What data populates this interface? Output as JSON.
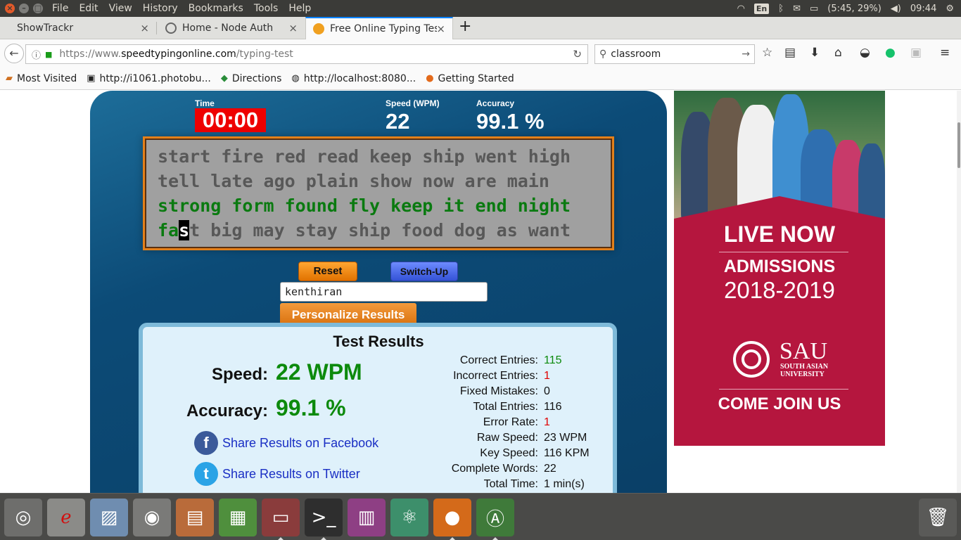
{
  "menubar": {
    "items": [
      "File",
      "Edit",
      "View",
      "History",
      "Bookmarks",
      "Tools",
      "Help"
    ],
    "tray": {
      "lang": "En",
      "battery": "(5:45, 29%)",
      "clock": "09:44"
    }
  },
  "tabs": [
    {
      "label": "ShowTrackr"
    },
    {
      "label": "Home - Node Auth"
    },
    {
      "label": "Free Online Typing Tes"
    }
  ],
  "navbar": {
    "url_prefix": "https://www.",
    "url_domain": "speedtypingonline.com",
    "url_path": "/typing-test",
    "search_value": "classroom"
  },
  "bookmarks": [
    {
      "label": "Most Visited"
    },
    {
      "label": "http://i1061.photobu..."
    },
    {
      "label": "Directions"
    },
    {
      "label": "http://localhost:8080..."
    },
    {
      "label": "Getting Started"
    }
  ],
  "typing_test": {
    "time_label": "Time",
    "time_value": "00:00",
    "speed_label": "Speed (WPM)",
    "speed_value": "22",
    "accuracy_label": "Accuracy",
    "accuracy_value": "99.1 %",
    "lines": [
      "start fire red read keep ship went high",
      "tell late ago plain show now are main",
      "strong form found fly keep it end night",
      "fast big may stay ship food dog as want"
    ],
    "line4_typed": "fa",
    "line4_cursor": "s",
    "line4_rest": "t big may stay ship food dog as want",
    "reset_label": "Reset",
    "switch_label": "Switch-Up",
    "name_value": "kenthiran",
    "personalize_label": "Personalize Results"
  },
  "results": {
    "title": "Test Results",
    "speed_label": "Speed:",
    "speed_value": "22 WPM",
    "accuracy_label": "Accuracy:",
    "accuracy_value": "99.1 %",
    "share_facebook": "Share Results on Facebook",
    "share_twitter": "Share Results on Twitter",
    "details": [
      {
        "key": "Correct Entries:",
        "value": "115",
        "color": "#0c8a0c"
      },
      {
        "key": "Incorrect Entries:",
        "value": "1",
        "color": "#e00000"
      },
      {
        "key": "Fixed Mistakes:",
        "value": "0",
        "color": "#111111"
      },
      {
        "key": "Total Entries:",
        "value": "116",
        "color": "#111111"
      },
      {
        "key": "Error Rate:",
        "value": "1",
        "color": "#e00000"
      },
      {
        "key": "Raw Speed:",
        "value": "23 WPM",
        "color": "#111111"
      },
      {
        "key": "Key Speed:",
        "value": "116 KPM",
        "color": "#111111"
      },
      {
        "key": "Complete Words:",
        "value": "22",
        "color": "#111111"
      },
      {
        "key": "Total Time:",
        "value": "1 min(s)",
        "color": "#111111"
      }
    ]
  },
  "ad": {
    "line1": "LIVE NOW",
    "line2": "ADMISSIONS",
    "line3": "2018-2019",
    "logo": "SAU",
    "logo_sub1": "SOUTH ASIAN",
    "logo_sub2": "UNIVERSITY",
    "line4": "COME JOIN US"
  },
  "dock": [
    {
      "name": "ubuntu-dash-icon",
      "color": "#6e6e6c"
    },
    {
      "name": "pdf-reader-icon",
      "color": "#8b8b88"
    },
    {
      "name": "image-viewer-icon",
      "color": "#6f8db0"
    },
    {
      "name": "camera-app-icon",
      "color": "#7a7a78"
    },
    {
      "name": "impress-icon",
      "color": "#b96b3a"
    },
    {
      "name": "calc-icon",
      "color": "#4f8f3d"
    },
    {
      "name": "file-manager-icon",
      "color": "#8a3c3c"
    },
    {
      "name": "terminal-icon",
      "color": "#2e2e2e"
    },
    {
      "name": "app-launcher-icon",
      "color": "#8e3f84"
    },
    {
      "name": "atom-icon",
      "color": "#3d8f6b"
    },
    {
      "name": "firefox-icon",
      "color": "#d46a1a"
    },
    {
      "name": "software-updater-icon",
      "color": "#3f7a3a"
    }
  ]
}
